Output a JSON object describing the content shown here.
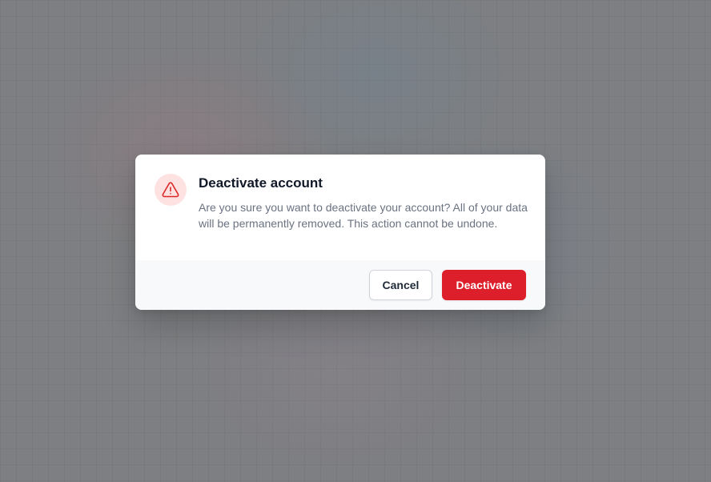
{
  "dialog": {
    "title": "Deactivate account",
    "message": "Are you sure you want to deactivate your account? All of your data will be permanently removed. This action cannot be undone.",
    "icon": "warning-triangle-icon",
    "cancel_label": "Cancel",
    "confirm_label": "Deactivate"
  },
  "colors": {
    "danger": "#dc1f2a",
    "danger_light": "#fee2e2",
    "footer_bg": "#f8f9fb"
  }
}
